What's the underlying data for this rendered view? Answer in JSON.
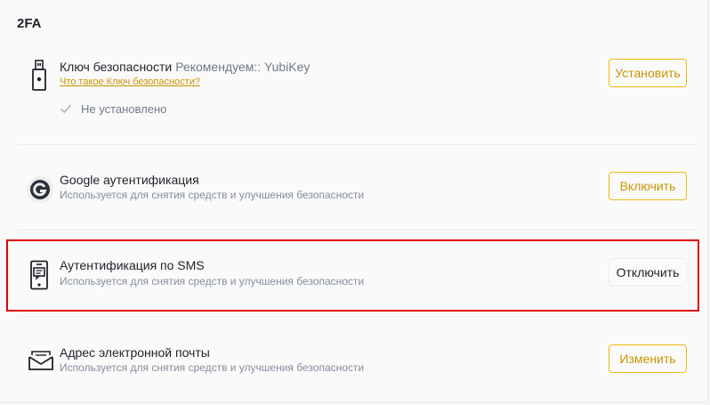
{
  "section": {
    "title": "2FA"
  },
  "items": [
    {
      "name": "Ключ безопасности",
      "recommend": "Рекомендуем:: YubiKey",
      "link": "Что такое Ключ безопасности?",
      "status": "Не установлено",
      "button": "Установить",
      "icon": "usb-security-key-icon"
    },
    {
      "name": "Google аутентификация",
      "description": "Используется для снятия средств и улучшения безопасности",
      "button": "Включить",
      "icon": "google-authenticator-icon"
    },
    {
      "name": "Аутентификация по SMS",
      "description": "Используется для снятия средств и улучшения безопасности",
      "button": "Отключить",
      "icon": "phone-sms-icon"
    },
    {
      "name": "Адрес электронной почты",
      "description": "Используется для снятия средств и улучшения безопасности",
      "button": "Изменить",
      "icon": "email-icon"
    }
  ],
  "colors": {
    "accent": "#f0b90b",
    "accent_text": "#c99400",
    "highlight": "#e30000"
  }
}
